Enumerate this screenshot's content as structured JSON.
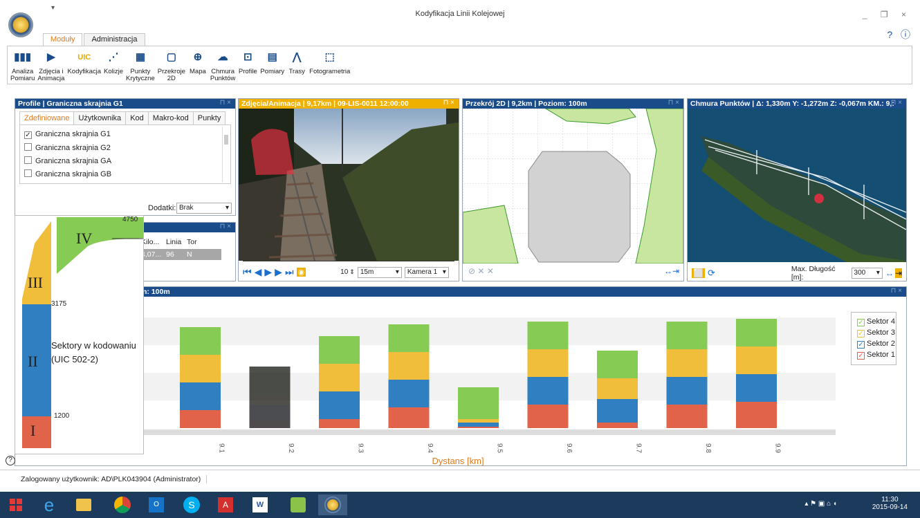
{
  "window": {
    "title": "Kodyfikacja Linii Kolejowej",
    "qat_glyph": "▾",
    "controls": "_ ❐ ×",
    "help": "? ⓘ"
  },
  "tabs": [
    "Moduły",
    "Administracja"
  ],
  "ribbon": [
    {
      "l1": "Analiza",
      "l2": "Pomiaru",
      "icon": "bar-analysis-icon"
    },
    {
      "l1": "Zdjęcia i",
      "l2": "Animacja",
      "icon": "film-icon"
    },
    {
      "l1": "Kodyfikacja",
      "l2": "",
      "icon": "uic-icon"
    },
    {
      "l1": "Kolizje",
      "l2": "",
      "icon": "collision-icon"
    },
    {
      "l1": "Punkty",
      "l2": "Krytyczne",
      "icon": "table-icon"
    },
    {
      "l1": "Przekroje",
      "l2": "2D",
      "icon": "section-icon"
    },
    {
      "l1": "Mapa",
      "l2": "",
      "icon": "map-icon"
    },
    {
      "l1": "Chmura",
      "l2": "Punktów",
      "icon": "cloud-icon"
    },
    {
      "l1": "Profile",
      "l2": "",
      "icon": "profile-icon"
    },
    {
      "l1": "Pomiary",
      "l2": "",
      "icon": "disk-icon"
    },
    {
      "l1": "Trasy",
      "l2": "",
      "icon": "route-icon"
    },
    {
      "l1": "Fotogrametria",
      "l2": "",
      "icon": "cube-icon"
    }
  ],
  "profile_panel": {
    "title": "Profile | Graniczna skrajnia G1",
    "tabs": [
      "Zdefiniowane",
      "Użytkownika",
      "Kod",
      "Makro-kod",
      "Punkty"
    ],
    "items": [
      {
        "label": "Graniczna skrajnia G1",
        "checked": true
      },
      {
        "label": "Graniczna skrajnia G2",
        "checked": false
      },
      {
        "label": "Graniczna skrajnia GA",
        "checked": false
      },
      {
        "label": "Graniczna skrajnia GB",
        "checked": false
      }
    ],
    "dodatki_label": "Dodatki:",
    "dodatki_value": "Brak"
  },
  "small_table": {
    "headers": [
      "Kilo...",
      "Linia",
      "Tor"
    ],
    "row": [
      "4,07...",
      "96",
      "N"
    ]
  },
  "photo_panel": {
    "title": "Zdjęcia/Animacja | 9,17km | 09-LIS-0011 12:00:00",
    "step": "10",
    "distance": "15m",
    "camera": "Kamera 1"
  },
  "section_panel": {
    "title": "Przekrój 2D | 9,2km | Poziom: 100m"
  },
  "cloud_panel": {
    "title": "Chmura Punktów | Δ: 1,330m Y: -1,272m Z: -0,067m  KM.: 9,:",
    "maxlen_label": "Max. Długość [m]:",
    "maxlen_value": "300"
  },
  "chart_panel": {
    "title": "n: 100m"
  },
  "overlay": {
    "sector_labels": [
      "IV",
      "III",
      "II",
      "I"
    ],
    "heights": [
      "4750",
      "3175",
      "1200"
    ],
    "caption_line1": "Sektory w kodowaniu",
    "caption_line2": "(UIC 502-2)"
  },
  "chart_data": {
    "type": "bar",
    "stacked": true,
    "xlabel": "Dystans [km]",
    "categories": [
      "9.1",
      "9.2",
      "9.3",
      "9.4",
      "9.5",
      "9.6",
      "9.7",
      "9.8",
      "9.9"
    ],
    "series": [
      {
        "name": "Sektor 1",
        "color": "#e0634a",
        "values": [
          26,
          10,
          13,
          30,
          2,
          34,
          8,
          34,
          38
        ]
      },
      {
        "name": "Sektor 2",
        "color": "#2f7fc1",
        "values": [
          40,
          24,
          40,
          40,
          6,
          40,
          34,
          40,
          40
        ]
      },
      {
        "name": "Sektor 3",
        "color": "#f0be3a",
        "values": [
          40,
          15,
          40,
          40,
          5,
          40,
          30,
          40,
          40
        ]
      },
      {
        "name": "Sektor 4",
        "color": "#86cb53",
        "values": [
          40,
          40,
          40,
          40,
          46,
          40,
          40,
          40,
          40
        ]
      }
    ],
    "legend": [
      "Sektor 4",
      "Sektor 3",
      "Sektor 2",
      "Sektor 1"
    ],
    "legend_position": "right",
    "highlighted_category": "9.2"
  },
  "status": {
    "user": "Zalogowany użytkownik: AD\\PLK043904 (Administrator)"
  },
  "taskbar": {
    "time": "11:30",
    "date": "2015-09-14"
  }
}
